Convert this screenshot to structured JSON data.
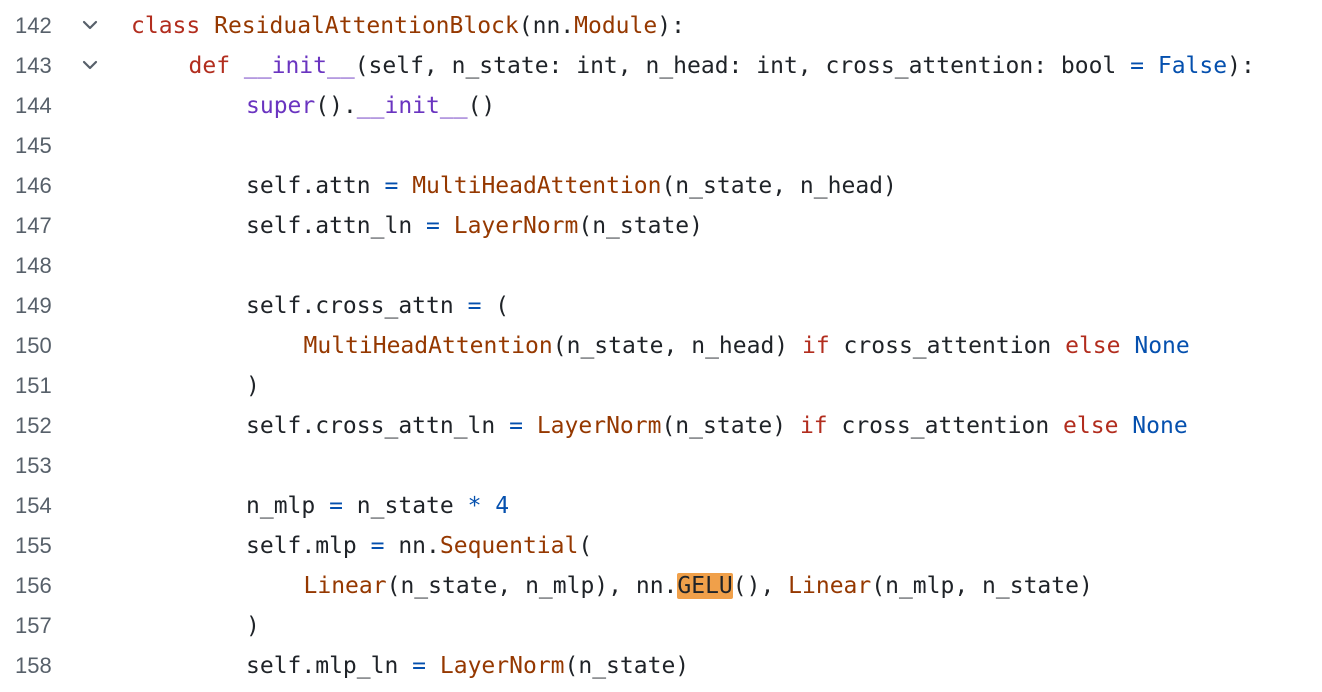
{
  "colors": {
    "keyword": "#b22d1e",
    "class_name": "#953800",
    "builtin": "#6a34c0",
    "constant": "#0550ae",
    "text": "#1f2328",
    "line_number": "#57606a",
    "highlight": "#f0a04a"
  },
  "fold_icon": "chevron-down-icon",
  "lines": [
    {
      "number": "142",
      "foldable": true,
      "indent": 0,
      "tokens": [
        {
          "t": "class",
          "c": "kw"
        },
        {
          "t": " ",
          "c": "plain"
        },
        {
          "t": "ResidualAttentionBlock",
          "c": "cls"
        },
        {
          "t": "(nn.",
          "c": "plain"
        },
        {
          "t": "Module",
          "c": "cls"
        },
        {
          "t": "):",
          "c": "plain"
        }
      ]
    },
    {
      "number": "143",
      "foldable": true,
      "indent": 1,
      "tokens": [
        {
          "t": "def",
          "c": "kw"
        },
        {
          "t": " ",
          "c": "plain"
        },
        {
          "t": "__init__",
          "c": "bi"
        },
        {
          "t": "(self, n_state: int, n_head: int, cross_attention: bool ",
          "c": "plain"
        },
        {
          "t": "=",
          "c": "const"
        },
        {
          "t": " ",
          "c": "plain"
        },
        {
          "t": "False",
          "c": "const"
        },
        {
          "t": "):",
          "c": "plain"
        }
      ]
    },
    {
      "number": "144",
      "foldable": false,
      "indent": 2,
      "tokens": [
        {
          "t": "super",
          "c": "bi"
        },
        {
          "t": "().",
          "c": "plain"
        },
        {
          "t": "__init__",
          "c": "bi"
        },
        {
          "t": "()",
          "c": "plain"
        }
      ]
    },
    {
      "number": "145",
      "foldable": false,
      "indent": 0,
      "tokens": []
    },
    {
      "number": "146",
      "foldable": false,
      "indent": 2,
      "tokens": [
        {
          "t": "self.attn ",
          "c": "plain"
        },
        {
          "t": "=",
          "c": "const"
        },
        {
          "t": " ",
          "c": "plain"
        },
        {
          "t": "MultiHeadAttention",
          "c": "cls"
        },
        {
          "t": "(n_state, n_head)",
          "c": "plain"
        }
      ]
    },
    {
      "number": "147",
      "foldable": false,
      "indent": 2,
      "tokens": [
        {
          "t": "self.attn_ln ",
          "c": "plain"
        },
        {
          "t": "=",
          "c": "const"
        },
        {
          "t": " ",
          "c": "plain"
        },
        {
          "t": "LayerNorm",
          "c": "cls"
        },
        {
          "t": "(n_state)",
          "c": "plain"
        }
      ]
    },
    {
      "number": "148",
      "foldable": false,
      "indent": 0,
      "tokens": []
    },
    {
      "number": "149",
      "foldable": false,
      "indent": 2,
      "tokens": [
        {
          "t": "self.cross_attn ",
          "c": "plain"
        },
        {
          "t": "=",
          "c": "const"
        },
        {
          "t": " (",
          "c": "plain"
        }
      ]
    },
    {
      "number": "150",
      "foldable": false,
      "indent": 3,
      "tokens": [
        {
          "t": "MultiHeadAttention",
          "c": "cls"
        },
        {
          "t": "(n_state, n_head) ",
          "c": "plain"
        },
        {
          "t": "if",
          "c": "kw"
        },
        {
          "t": " cross_attention ",
          "c": "plain"
        },
        {
          "t": "else",
          "c": "kw"
        },
        {
          "t": " ",
          "c": "plain"
        },
        {
          "t": "None",
          "c": "const"
        }
      ]
    },
    {
      "number": "151",
      "foldable": false,
      "indent": 2,
      "tokens": [
        {
          "t": ")",
          "c": "plain"
        }
      ]
    },
    {
      "number": "152",
      "foldable": false,
      "indent": 2,
      "tokens": [
        {
          "t": "self.cross_attn_ln ",
          "c": "plain"
        },
        {
          "t": "=",
          "c": "const"
        },
        {
          "t": " ",
          "c": "plain"
        },
        {
          "t": "LayerNorm",
          "c": "cls"
        },
        {
          "t": "(n_state) ",
          "c": "plain"
        },
        {
          "t": "if",
          "c": "kw"
        },
        {
          "t": " cross_attention ",
          "c": "plain"
        },
        {
          "t": "else",
          "c": "kw"
        },
        {
          "t": " ",
          "c": "plain"
        },
        {
          "t": "None",
          "c": "const"
        }
      ]
    },
    {
      "number": "153",
      "foldable": false,
      "indent": 0,
      "tokens": []
    },
    {
      "number": "154",
      "foldable": false,
      "indent": 2,
      "tokens": [
        {
          "t": "n_mlp ",
          "c": "plain"
        },
        {
          "t": "=",
          "c": "const"
        },
        {
          "t": " n_state ",
          "c": "plain"
        },
        {
          "t": "*",
          "c": "const"
        },
        {
          "t": " ",
          "c": "plain"
        },
        {
          "t": "4",
          "c": "const"
        }
      ]
    },
    {
      "number": "155",
      "foldable": false,
      "indent": 2,
      "tokens": [
        {
          "t": "self.mlp ",
          "c": "plain"
        },
        {
          "t": "=",
          "c": "const"
        },
        {
          "t": " nn.",
          "c": "plain"
        },
        {
          "t": "Sequential",
          "c": "cls"
        },
        {
          "t": "(",
          "c": "plain"
        }
      ]
    },
    {
      "number": "156",
      "foldable": false,
      "indent": 3,
      "tokens": [
        {
          "t": "Linear",
          "c": "cls"
        },
        {
          "t": "(n_state, n_mlp), nn.",
          "c": "plain"
        },
        {
          "t": "GELU",
          "c": "hl"
        },
        {
          "t": "(), ",
          "c": "plain"
        },
        {
          "t": "Linear",
          "c": "cls"
        },
        {
          "t": "(n_mlp, n_state)",
          "c": "plain"
        }
      ]
    },
    {
      "number": "157",
      "foldable": false,
      "indent": 2,
      "tokens": [
        {
          "t": ")",
          "c": "plain"
        }
      ]
    },
    {
      "number": "158",
      "foldable": false,
      "indent": 2,
      "tokens": [
        {
          "t": "self.mlp_ln ",
          "c": "plain"
        },
        {
          "t": "=",
          "c": "const"
        },
        {
          "t": " ",
          "c": "plain"
        },
        {
          "t": "LayerNorm",
          "c": "cls"
        },
        {
          "t": "(n_state)",
          "c": "plain"
        }
      ]
    }
  ]
}
